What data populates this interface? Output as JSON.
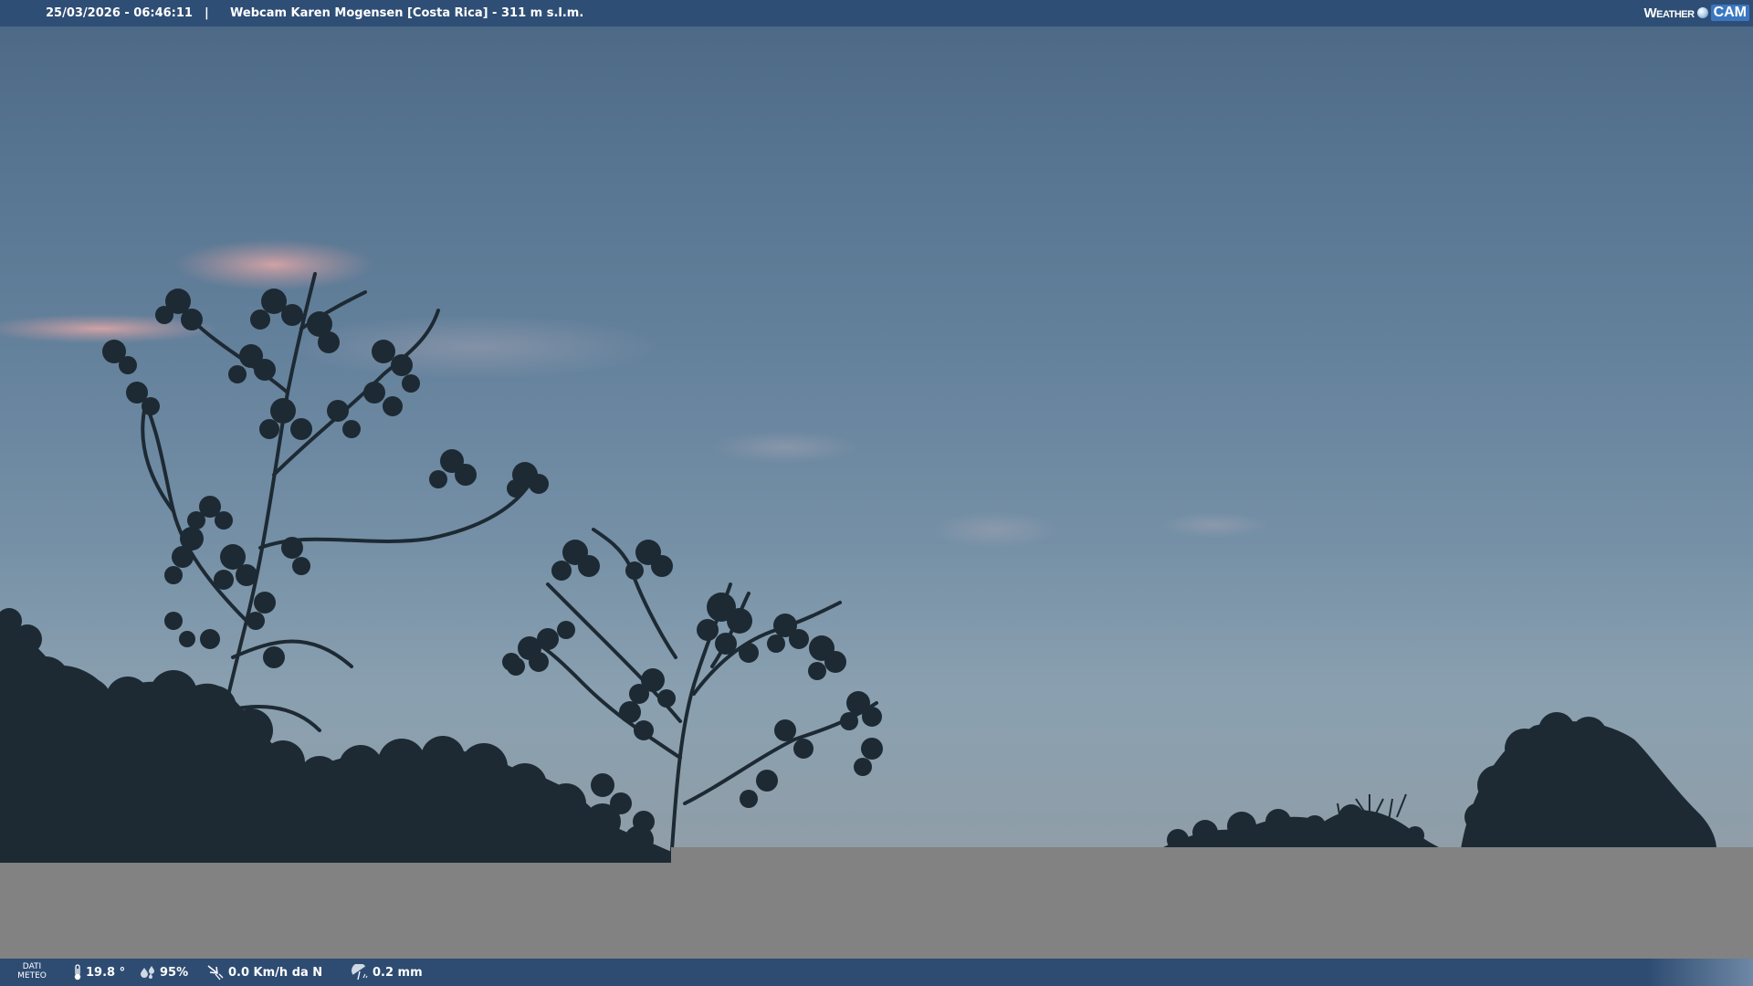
{
  "header": {
    "datetime": "25/03/2026 - 06:46:11",
    "separator": "|",
    "title": "Webcam Karen Mogensen [Costa Rica]  - 311 m s.l.m.",
    "brand_weather": "Weather",
    "brand_cam": "CAM"
  },
  "footer": {
    "label_line1": "DATI",
    "label_line2": "METEO",
    "temperature": "19.8 °",
    "humidity": "95%",
    "wind": "0.0 Km/h da N",
    "rain": "0.2 mm"
  },
  "icons": {
    "brand_globe": "globe-icon",
    "temperature": "thermometer-icon",
    "humidity": "drops-icon",
    "wind": "wind-icon",
    "rain": "umbrella-rain-icon"
  },
  "colors": {
    "bar": "#2f4e75",
    "band": "#828282",
    "foliage": "#1d2a33"
  }
}
